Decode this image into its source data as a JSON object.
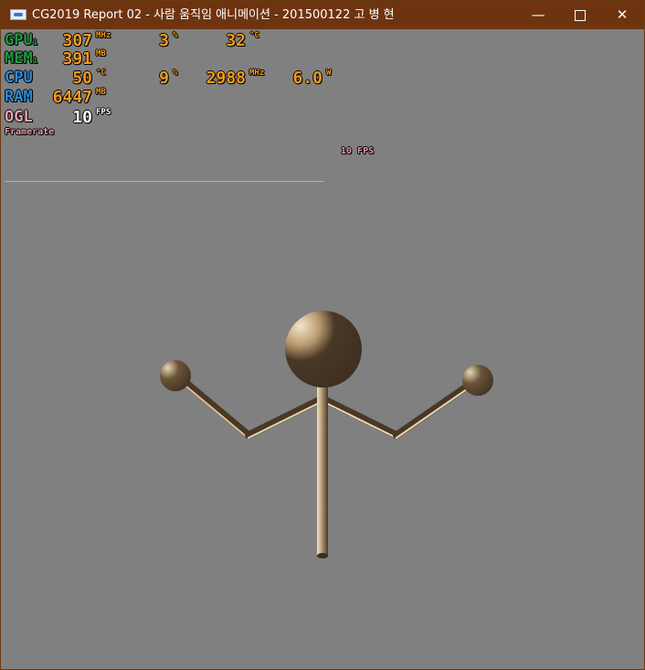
{
  "window": {
    "title": "CG2019 Report 02 - 사람 움직임 애니메이션 - 201500122 고 병 현",
    "minimize_glyph": "—",
    "close_glyph": "✕"
  },
  "hud": {
    "gpu": {
      "label": "GPU",
      "sub": "1",
      "clock": "307",
      "clock_unit": "MHz",
      "load": "3",
      "load_unit": "%",
      "temp": "32",
      "temp_unit": "°C"
    },
    "mem": {
      "label": "MEM",
      "sub": "1",
      "value": "391",
      "unit": "MB"
    },
    "cpu": {
      "label": "CPU",
      "temp": "50",
      "temp_unit": "°C",
      "load": "9",
      "load_unit": "%",
      "clock": "2988",
      "clock_unit": "MHz",
      "power": "6.0",
      "power_unit": "W"
    },
    "ram": {
      "label": "RAM",
      "value": "6447",
      "unit": "MB"
    },
    "ogl": {
      "label": "OGL",
      "value": "10",
      "unit": "FPS"
    },
    "framerate_label": "Framerate",
    "framerate_value": "10 FPS"
  },
  "colors": {
    "titlebar": "#6e3410",
    "background": "#808080",
    "gpu_label": "#1f9a3e",
    "mem_label": "#1f9a3e",
    "cpu_label": "#2a8ad8",
    "ram_label": "#2a8ad8",
    "ogl_label": "#e6a0aa",
    "value": "#f39a1e",
    "figure": "#4a3826",
    "figure_highlight": "#e9d7b4"
  }
}
